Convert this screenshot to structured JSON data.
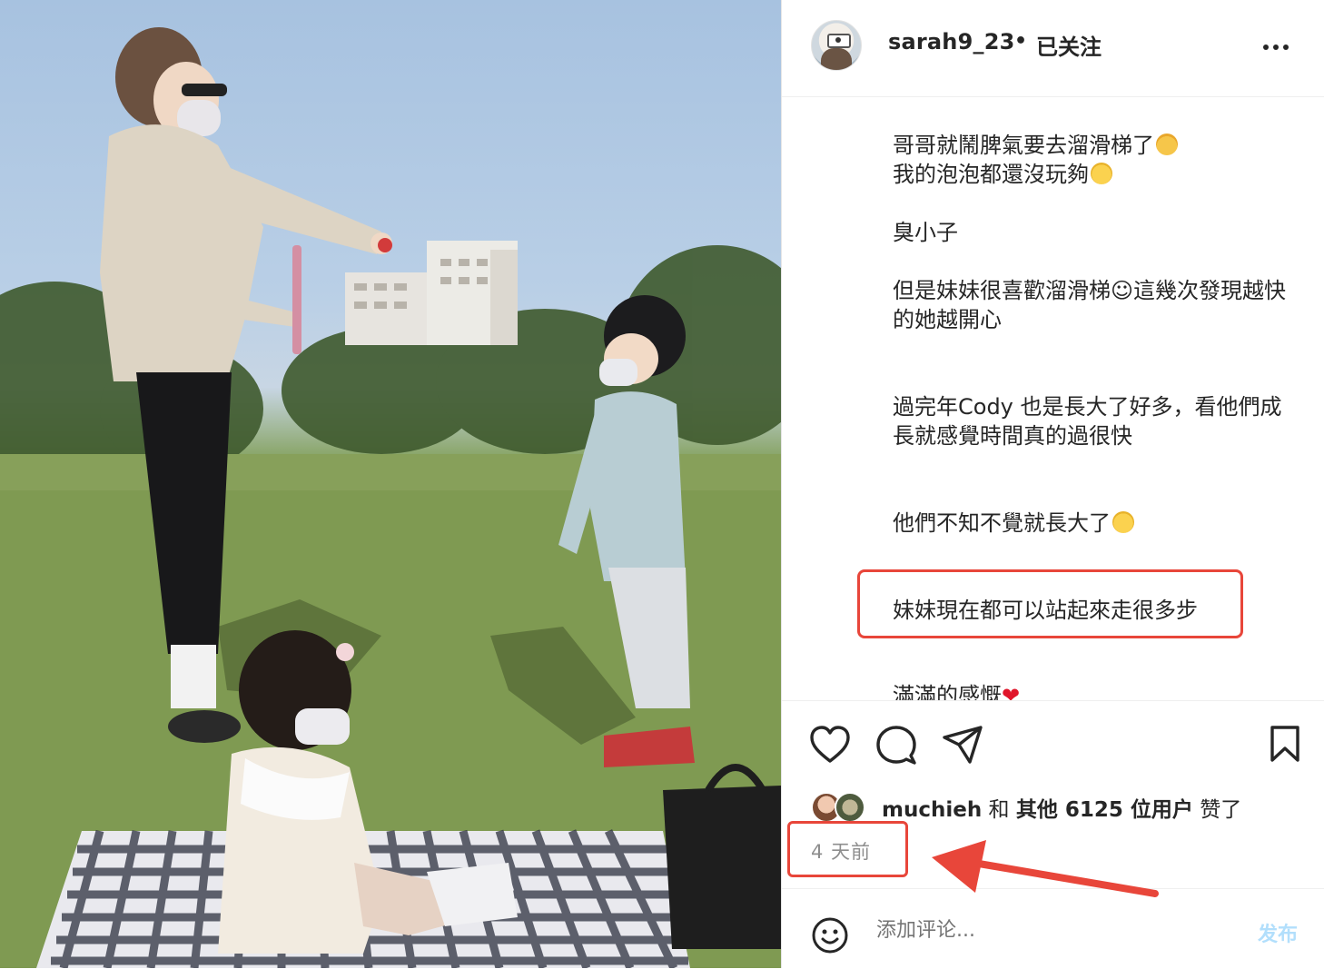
{
  "header": {
    "username": "sarah9_23",
    "separator": "•",
    "follow_status": "已关注"
  },
  "caption": {
    "lines": [
      "哥哥就鬧脾氣要去溜滑梯了",
      "我的泡泡都還沒玩夠",
      "臭小子",
      "但是妹妹很喜歡溜滑梯☺︎這幾次發現越快",
      "的她越開心",
      "過完年Cody 也是長大了好多，看他們成",
      "長就感覺時間真的過很快",
      "他們不知不覺就長大了",
      "妹妹現在都可以站起來走很多步",
      "滿滿的感慨"
    ]
  },
  "likes": {
    "user": "muchieh",
    "connector": "和",
    "others": "其他 6125 位用户",
    "suffix": "赞了"
  },
  "timestamp": "4 天前",
  "comment": {
    "placeholder": "添加评论...",
    "post_label": "发布"
  },
  "icons": {
    "like": "heart-icon",
    "comment": "comment-bubble-icon",
    "share": "paper-plane-icon",
    "save": "bookmark-icon",
    "emoji": "smiley-icon",
    "more": "more-options-icon"
  },
  "colors": {
    "highlight": "#e8463a",
    "post_button": "#b2dffc",
    "secondary_text": "#8e8e8e"
  }
}
